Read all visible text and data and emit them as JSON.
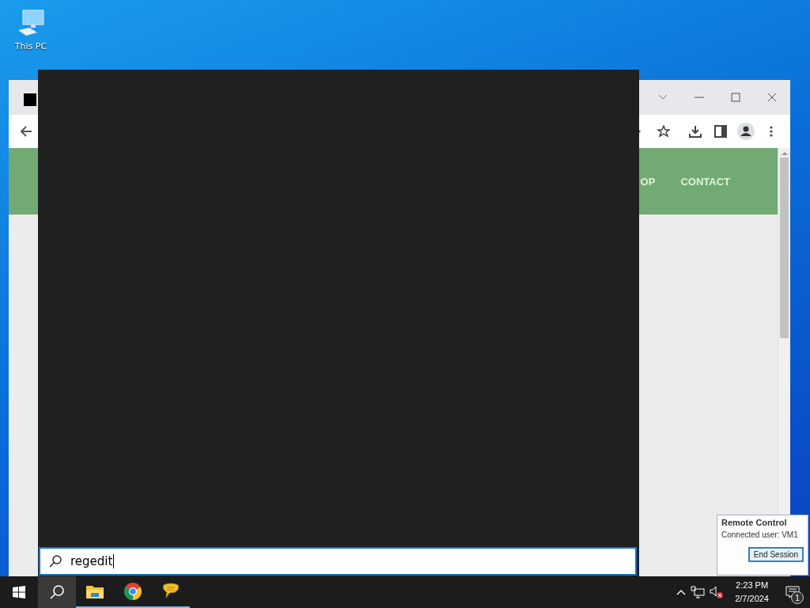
{
  "desktop_icons": [
    {
      "label": "This PC"
    }
  ],
  "browser": {
    "nav_items": [
      {
        "label": "OP"
      },
      {
        "label": "CONTACT"
      }
    ]
  },
  "start_search": {
    "value": "regedit"
  },
  "taskbar": {
    "search_selected": true,
    "apps": [
      {
        "kind": "explorer",
        "running": true
      },
      {
        "kind": "chrome",
        "running": true
      },
      {
        "kind": "chat",
        "running": true
      }
    ],
    "clock": {
      "time": "2:23 PM",
      "date": "2/7/2024"
    },
    "notification_count": "1"
  },
  "remote_popup": {
    "title": "Remote Control",
    "text": "Connected user: VM1",
    "button": "End Session"
  }
}
